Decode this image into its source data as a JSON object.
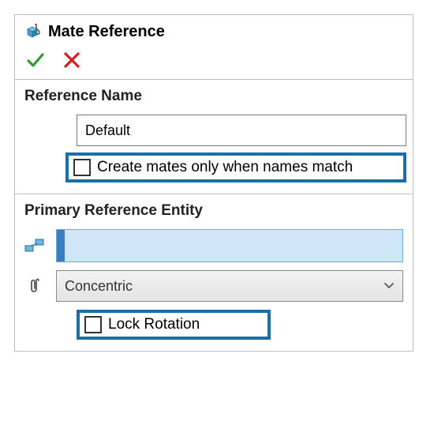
{
  "header": {
    "title": "Mate Reference"
  },
  "referenceName": {
    "sectionTitle": "Reference Name",
    "value": "Default",
    "createMatesLabel": "Create mates only when names match"
  },
  "primaryEntity": {
    "sectionTitle": "Primary Reference Entity",
    "mateTypeSelected": "Concentric",
    "lockRotationLabel": "Lock Rotation"
  }
}
